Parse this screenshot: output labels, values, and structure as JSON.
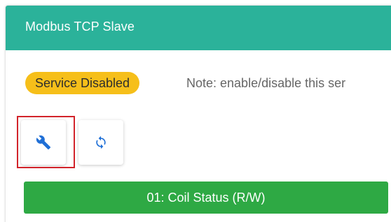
{
  "panel": {
    "title": "Modbus TCP Slave"
  },
  "status": {
    "badge_label": "Service Disabled",
    "badge_color": "#f6bf1a",
    "note": "Note: enable/disable this ser"
  },
  "toolbar": {
    "buttons": [
      {
        "icon": "wrench-icon",
        "highlighted": true
      },
      {
        "icon": "refresh-icon",
        "highlighted": false
      }
    ],
    "icon_color": "#1f6fd6",
    "highlight_color": "#d2232a"
  },
  "register_sections": [
    {
      "label": "01: Coil Status (R/W)",
      "color": "#2ea944"
    }
  ],
  "colors": {
    "header": "#2bb29a"
  }
}
